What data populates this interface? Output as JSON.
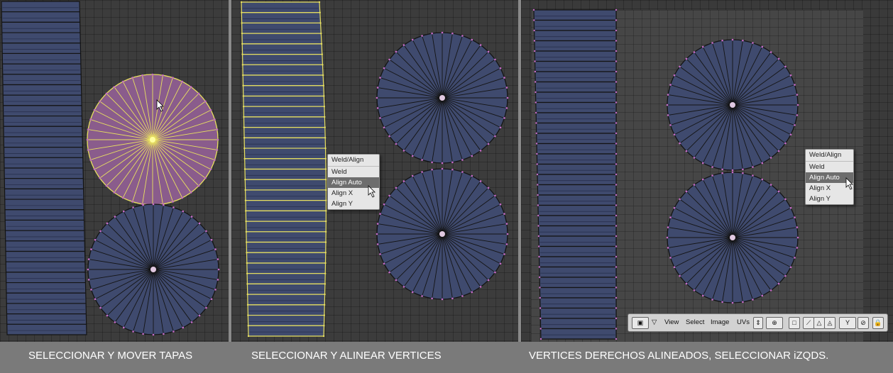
{
  "captions": {
    "panel1": "SELECCIONAR Y MOVER TAPAS",
    "panel2": "SELECCIONAR Y ALINEAR VERTICES",
    "panel3": "VERTICES DERECHOS ALINEADOS, SELECCIONAR iZQDS."
  },
  "context_menu": {
    "title": "Weld/Align",
    "items": [
      {
        "label": "Weld",
        "selected": false
      },
      {
        "label": "Align Auto",
        "selected": true
      },
      {
        "label": "Align X",
        "selected": false
      },
      {
        "label": "Align Y",
        "selected": false
      }
    ]
  },
  "header_menu": {
    "view": "View",
    "select": "Select",
    "image": "Image",
    "uvs": "UVs"
  },
  "colors": {
    "face_fill": "#3f4a6e",
    "selected_face_fill": "#8a5c8c",
    "edge": "#141414",
    "selected_edge": "#e8e060",
    "vertex": "#c86cc8",
    "grid_bg": "#3c3c3c",
    "caption_bg": "#7a7a7a"
  }
}
